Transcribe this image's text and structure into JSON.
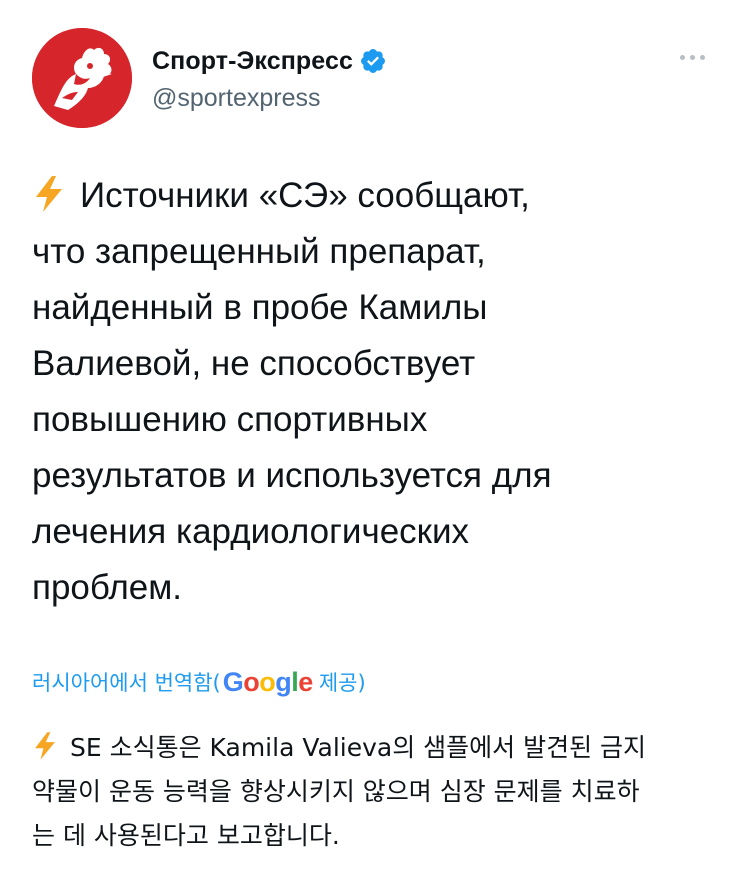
{
  "author": {
    "display_name": "Спорт-Экспресс",
    "handle": "@sportexpress",
    "verified": true,
    "avatar_icon": "rooster-logo-icon",
    "brand_color": "#d6252b"
  },
  "tweet": {
    "lines": [
      "Источники «СЭ» сообщают,",
      "что запрещенный препарат,",
      "найденный в пробе Камилы",
      "Валиевой, не способствует",
      "повышению спортивных",
      "результатов и используется для",
      "лечения кардиологических",
      "проблем."
    ],
    "leading_icon": "lightning-bolt-icon"
  },
  "translation": {
    "label_prefix": "러시아어에서 번역함(",
    "provider": "Google",
    "label_suffix": " 제공)",
    "lines": [
      "SE 소식통은 Kamila Valieva의 샘플에서 발견된 금지",
      "약물이 운동 능력을 향상시키지 않으며 심장 문제를 치료하",
      "는 데 사용된다고 보고합니다."
    ]
  },
  "colors": {
    "link": "#1d9bf0",
    "secondary_text": "#536471",
    "verified": "#1d9bf0",
    "bolt": "#f6a623"
  }
}
